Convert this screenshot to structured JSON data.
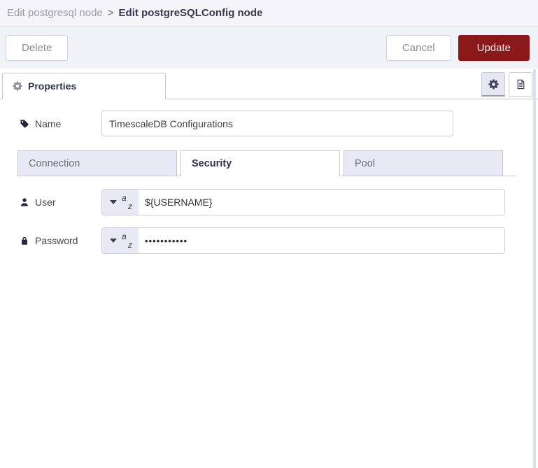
{
  "header": {
    "breadcrumb_parent": "Edit postgresql node",
    "breadcrumb_separator": ">",
    "breadcrumb_current": "Edit postgreSQLConfig node"
  },
  "toolbar": {
    "delete_label": "Delete",
    "cancel_label": "Cancel",
    "update_label": "Update"
  },
  "properties_bar": {
    "tab_label": "Properties"
  },
  "form": {
    "name_field": {
      "label": "Name",
      "value": "TimescaleDB Configurations"
    },
    "config_tabs": [
      {
        "label": "Connection",
        "active": false
      },
      {
        "label": "Security",
        "active": true
      },
      {
        "label": "Pool",
        "active": false
      }
    ],
    "user_field": {
      "label": "User",
      "value": "${USERNAME}",
      "type_icon_top": "a",
      "type_icon_bottom": "z"
    },
    "password_field": {
      "label": "Password",
      "value": "•••••••••••",
      "type_icon_top": "a",
      "type_icon_bottom": "z"
    }
  },
  "colors": {
    "update_button_bg": "#8C1919",
    "lavender_fill": "#E8E9F4",
    "tab_border": "#C6C6D8",
    "header_bg": "#F4F4F9"
  }
}
